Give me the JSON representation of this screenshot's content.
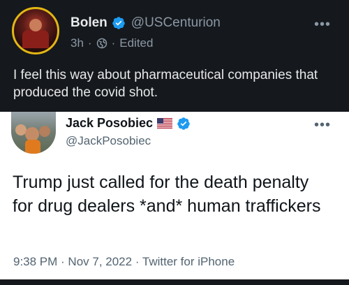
{
  "outer_post": {
    "name": "Bolen",
    "handle": "@USCenturion",
    "time": "3h",
    "separator": "·",
    "edited": "Edited",
    "more": "•••",
    "text": "I feel this way about pharmaceutical companies that produced the covid shot.",
    "verified_color": "#1d9bf0",
    "avatar_ring_color": "#e2b714"
  },
  "quoted_post": {
    "name": "Jack Posobiec",
    "handle": "@JackPosobiec",
    "more": "•••",
    "text": "Trump just called for the death penalty for drug dealers *and* human traffickers",
    "timestamp": "9:38 PM · Nov 7, 2022 · Twitter for iPhone",
    "verified_color": "#1d9bf0"
  }
}
